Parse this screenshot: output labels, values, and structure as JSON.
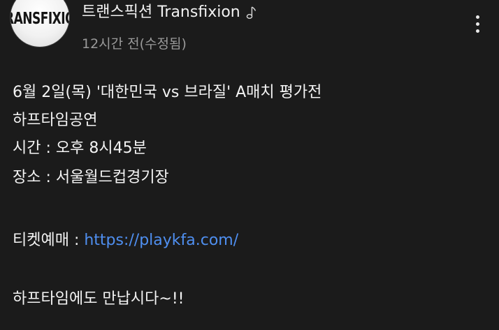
{
  "post": {
    "avatar_text": "RANSFIXIO",
    "author": "트랜스픽션 Transfixion",
    "author_badge_icon": "music-note-icon",
    "timestamp": "12시간 전(수정됨)",
    "more_icon": "more-vert-icon",
    "lines": [
      "6월 2일(목) '대한민국 vs 브라질' A매치 평가전",
      "하프타임공연",
      "시간 : 오후 8시45분",
      "장소 : 서울월드컵경기장"
    ],
    "ticket_label": "티켓예매 : ",
    "ticket_link": "https://playkfa.com/",
    "closing": "하프타임에도 만납시다~!!"
  },
  "colors": {
    "background": "#1b1b1b",
    "text": "#f4f4f4",
    "muted": "#9a9a9a",
    "link": "#4f8ff0"
  }
}
